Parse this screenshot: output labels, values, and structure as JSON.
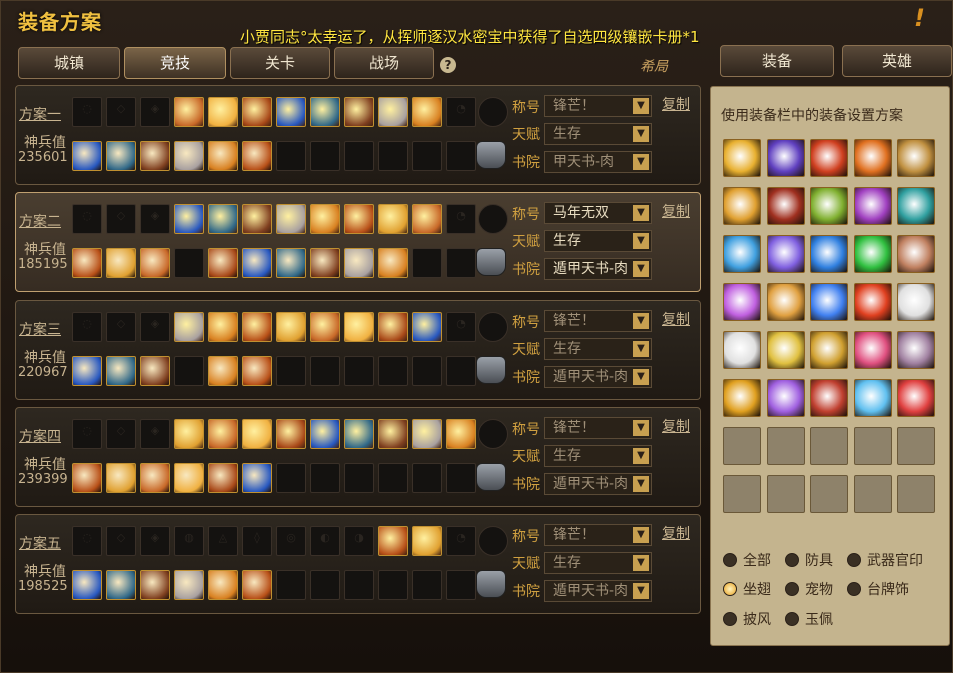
{
  "title": "装备方案",
  "notice": "小贾同志°太幸运了，从挥师逐汉水密宝中获得了自选四级镶嵌卡册*1",
  "alert_icon": "exclamation-icon",
  "tabs": [
    {
      "label": "城镇",
      "active": false
    },
    {
      "label": "竞技",
      "active": true
    },
    {
      "label": "关卡",
      "active": false
    },
    {
      "label": "战场",
      "active": false
    }
  ],
  "help_icon": "question-icon",
  "brand": "希局",
  "right_tabs": [
    {
      "label": "装备"
    },
    {
      "label": "英雄"
    }
  ],
  "field_labels": {
    "title": "称号",
    "talent": "天赋",
    "academy": "书院"
  },
  "plans": [
    {
      "name": "方案一",
      "score_label": "神兵值",
      "score": "235601",
      "title_value": "锋芒！",
      "talent": "生存",
      "academy": "甲天书-肉",
      "copy": "复制",
      "selected": false,
      "row1_filled": [
        false,
        false,
        false,
        true,
        true,
        true,
        true,
        true,
        true,
        true,
        true,
        false
      ],
      "row2_filled": [
        true,
        true,
        true,
        true,
        true,
        true,
        false,
        false,
        false,
        false,
        false,
        false
      ]
    },
    {
      "name": "方案二",
      "score_label": "神兵值",
      "score": "185195",
      "title_value": "马年无双",
      "talent": "生存",
      "academy": "遁甲天书-肉",
      "copy": "复制",
      "selected": true,
      "row1_filled": [
        false,
        false,
        false,
        true,
        true,
        true,
        true,
        true,
        true,
        true,
        true,
        false
      ],
      "row2_filled": [
        true,
        true,
        true,
        false,
        true,
        true,
        true,
        true,
        true,
        true,
        false,
        false
      ]
    },
    {
      "name": "方案三",
      "score_label": "神兵值",
      "score": "220967",
      "title_value": "锋芒！",
      "talent": "生存",
      "academy": "遁甲天书-肉",
      "copy": "复制",
      "selected": false,
      "row1_filled": [
        false,
        false,
        false,
        true,
        true,
        true,
        true,
        true,
        true,
        true,
        true,
        false
      ],
      "row2_filled": [
        true,
        true,
        true,
        false,
        true,
        true,
        false,
        false,
        false,
        false,
        false,
        false
      ]
    },
    {
      "name": "方案四",
      "score_label": "神兵值",
      "score": "239399",
      "title_value": "锋芒！",
      "talent": "生存",
      "academy": "遁甲天书-肉",
      "copy": "复制",
      "selected": false,
      "row1_filled": [
        false,
        false,
        false,
        true,
        true,
        true,
        true,
        true,
        true,
        true,
        true,
        true
      ],
      "row2_filled": [
        true,
        true,
        true,
        true,
        true,
        true,
        false,
        false,
        false,
        false,
        false,
        false
      ]
    },
    {
      "name": "方案五",
      "score_label": "神兵值",
      "score": "198525",
      "title_value": "锋芒！",
      "talent": "生存",
      "academy": "遁甲天书-肉",
      "copy": "复制",
      "selected": false,
      "row1_filled": [
        false,
        false,
        false,
        false,
        false,
        false,
        false,
        false,
        false,
        true,
        true,
        false
      ],
      "row2_filled": [
        true,
        true,
        true,
        true,
        true,
        true,
        false,
        false,
        false,
        false,
        false,
        false
      ]
    }
  ],
  "right_panel": {
    "description": "使用装备栏中的装备设置方案",
    "filled_count": 30,
    "total": 40
  },
  "filters": [
    {
      "label": "全部",
      "selected": false
    },
    {
      "label": "防具",
      "selected": false
    },
    {
      "label": "武器官印",
      "selected": false
    },
    {
      "label": "坐翅",
      "selected": true
    },
    {
      "label": "宠物",
      "selected": false
    },
    {
      "label": "台牌饰",
      "selected": false
    },
    {
      "label": "披风",
      "selected": false
    },
    {
      "label": "玉佩",
      "selected": false
    }
  ],
  "colors": {
    "gold": "#f0c040",
    "notice": "#ffe640",
    "field_label": "#d0a040",
    "panel_bg": "#c4b48e"
  }
}
